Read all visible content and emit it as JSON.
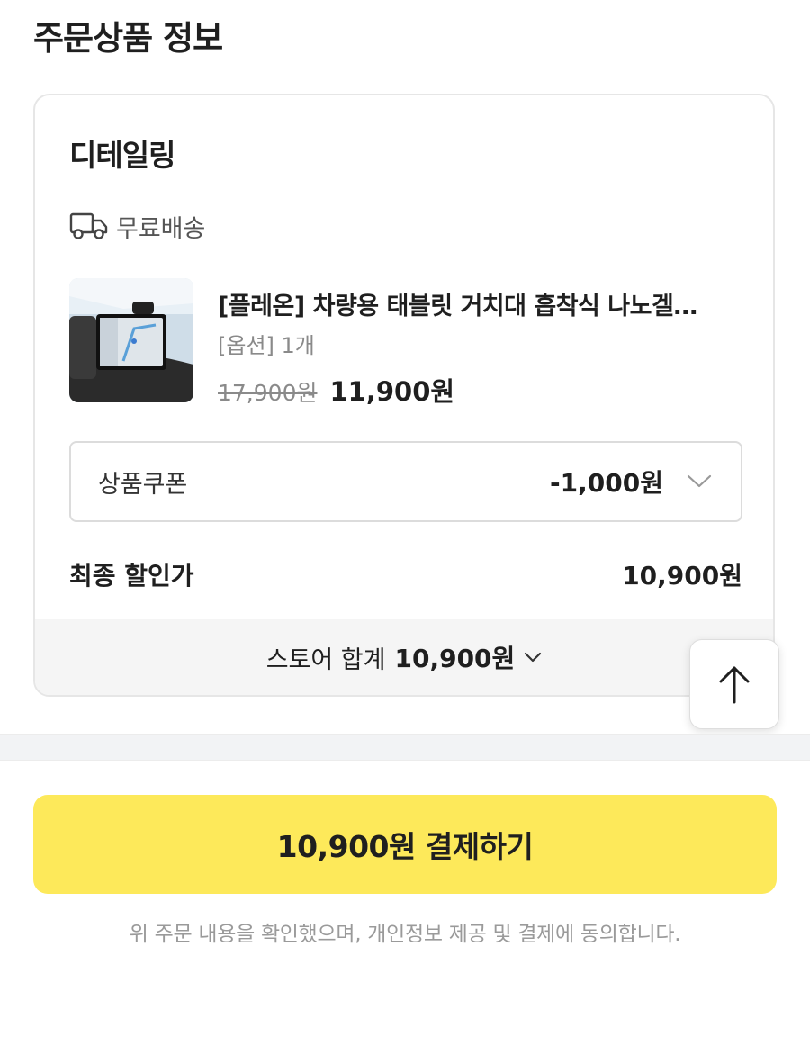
{
  "section_title": "주문상품 정보",
  "store": {
    "name": "디테일링",
    "shipping_label": "무료배송",
    "shipping_icon": "truck-icon",
    "product": {
      "name": "[플레온] 차량용 태블릿 거치대 흡착식 나노겔…",
      "option": "[옵션] 1개",
      "original_price": "17,900원",
      "sale_price": "11,900원"
    },
    "coupon": {
      "label": "상품쿠폰",
      "value": "-1,000원",
      "icon": "chevron-down-icon"
    },
    "final": {
      "label": "최종 할인가",
      "value": "10,900원"
    },
    "total": {
      "label": "스토어 합계",
      "value": "10,900원"
    }
  },
  "scroll_top_icon": "arrow-up-icon",
  "pay_button_label": "10,900원 결제하기",
  "agreement_text": "위 주문 내용을 확인했으며, 개인정보 제공 및 결제에 동의합니다.",
  "colors": {
    "accent": "#fde95a",
    "text": "#1f1f1f",
    "muted": "#8a8a8a"
  }
}
